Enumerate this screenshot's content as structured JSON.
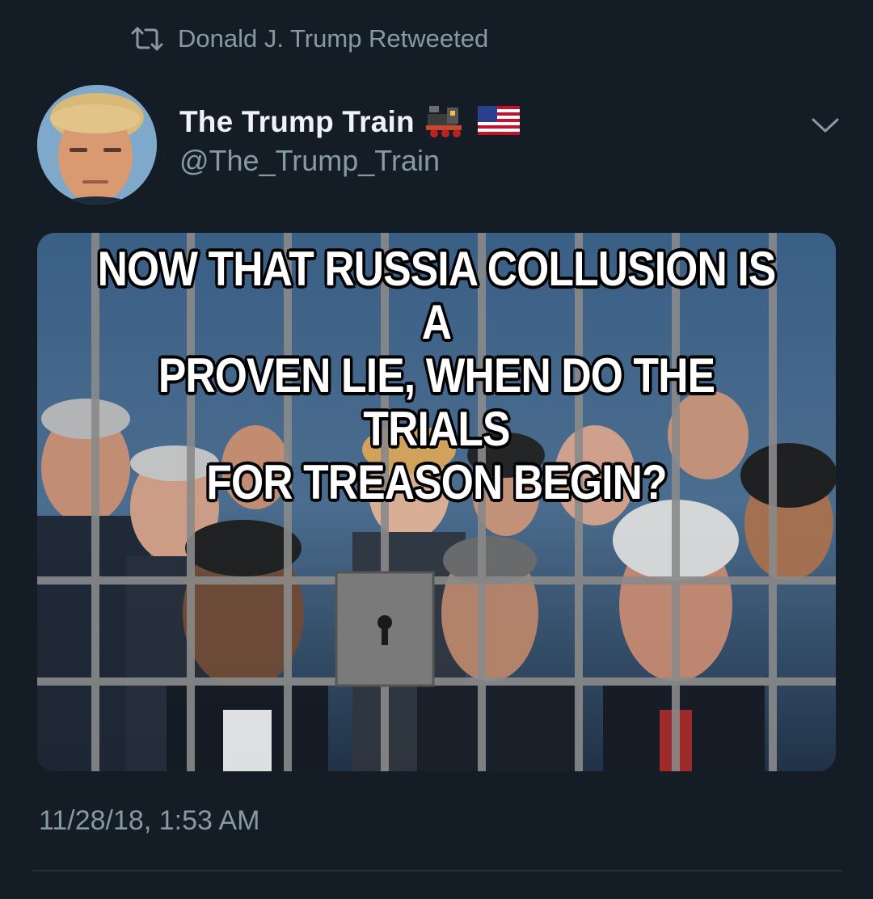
{
  "retweet": {
    "icon": "retweet-icon",
    "text": "Donald J. Trump Retweeted"
  },
  "author": {
    "display_name": "The Trump Train",
    "handle": "@The_Trump_Train",
    "name_emojis": [
      "locomotive-emoji",
      "us-flag-emoji"
    ],
    "avatar": "profile-photo"
  },
  "menu": {
    "icon": "chevron-down-icon"
  },
  "media": {
    "caption": "NOW THAT RUSSIA COLLUSION IS A\nPROVEN LIE, WHEN DO THE TRIALS\nFOR TREASON BEGIN?",
    "description_icon": "meme-image"
  },
  "tweet": {
    "timestamp": "11/28/18, 1:53 AM"
  },
  "colors": {
    "background": "#141d26",
    "secondary_text": "#8899a6",
    "primary_text": "#f0f3f5",
    "divider": "#22303c"
  }
}
